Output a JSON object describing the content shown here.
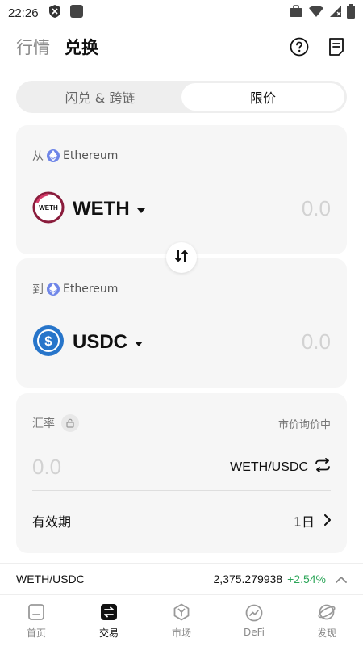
{
  "status_bar": {
    "time": "22:26"
  },
  "header": {
    "tabs": [
      {
        "label": "行情",
        "active": false
      },
      {
        "label": "兑换",
        "active": true
      }
    ]
  },
  "mode_switch": {
    "options": [
      {
        "label": "闪兑 & 跨链",
        "active": false
      },
      {
        "label": "限价",
        "active": true
      }
    ]
  },
  "from": {
    "prefix": "从",
    "chain": "Ethereum",
    "token": "WETH",
    "logo_text": "WETH",
    "amount": "0.0"
  },
  "to": {
    "prefix": "到",
    "chain": "Ethereum",
    "token": "USDC",
    "amount": "0.0"
  },
  "rate": {
    "label": "汇率",
    "status": "市价询价中",
    "value": "0.0",
    "pair": "WETH/USDC",
    "validity_label": "有效期",
    "validity_value": "1日"
  },
  "ticker": {
    "pair": "WETH/USDC",
    "price": "2,375.279938",
    "change": "+2.54%"
  },
  "tabbar": {
    "items": [
      {
        "label": "首页",
        "icon": "home-icon",
        "active": false
      },
      {
        "label": "交易",
        "icon": "trade-icon",
        "active": true
      },
      {
        "label": "市场",
        "icon": "market-icon",
        "active": false
      },
      {
        "label": "DeFi",
        "icon": "defi-icon",
        "active": false
      },
      {
        "label": "发现",
        "icon": "discover-icon",
        "active": false
      }
    ]
  },
  "colors": {
    "positive": "#2aa557",
    "eth": "#6f86e8",
    "usdc": "#2775ca",
    "weth_ring": "#8a1c3c"
  }
}
